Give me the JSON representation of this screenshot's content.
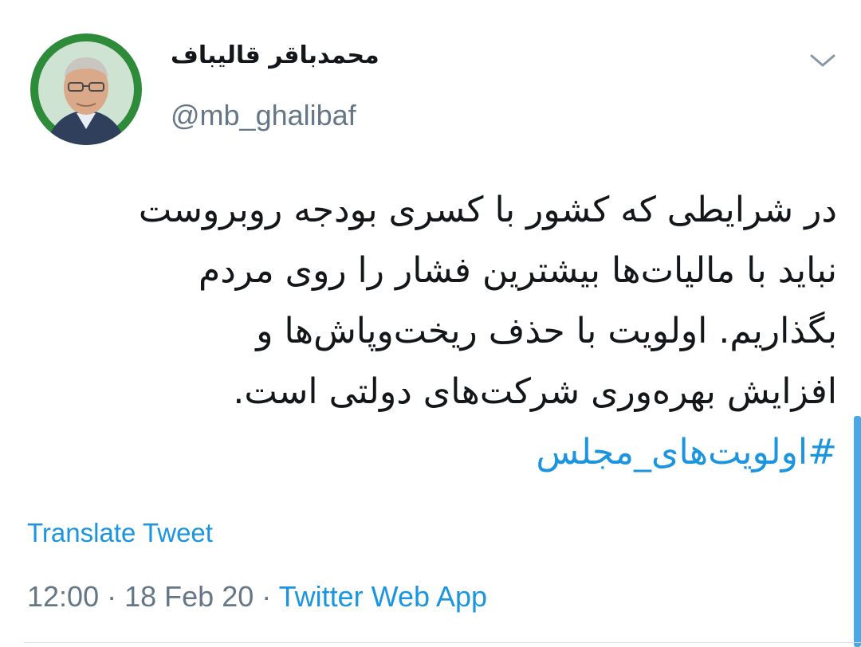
{
  "tweet": {
    "author": {
      "display_name": "محمدباقر قالیباف",
      "handle": "@mb_ghalibaf",
      "avatar_icon": "profile-photo"
    },
    "text_lines": [
      "در شرایطی که کشور با کسری بودجه روبروست",
      "نباید با مالیات‌ها بیشترین فشار را روی مردم",
      "بگذاریم. اولویت با حذف ریخت‌وپاش‌ها و",
      "افزایش بهره‌وری شرکت‌های دولتی است."
    ],
    "hashtag": "#اولویت‌های_مجلس",
    "translate_label": "Translate Tweet",
    "time": "12:00",
    "separator": "·",
    "date": "18 Feb 20",
    "source": "Twitter Web App",
    "menu_icon": "chevron-down-icon"
  },
  "colors": {
    "link": "#1b95e0",
    "secondary_text": "#657786",
    "primary_text": "#14171a",
    "avatar_ring": "#2e8b3a"
  }
}
